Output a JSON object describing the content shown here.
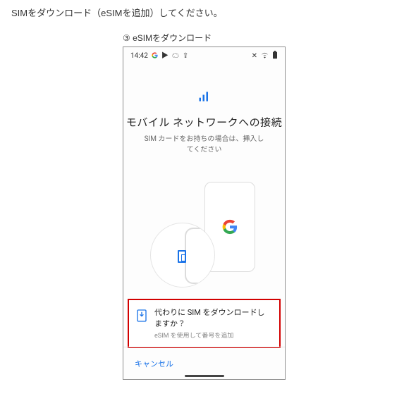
{
  "page": {
    "intro": "SIMをダウンロード（eSIMを追加）してください。",
    "caption": "③ eSIMをダウンロード"
  },
  "status": {
    "time": "14:42",
    "left_icons": [
      "G",
      "play-icon",
      "cloud-icon",
      "share-icon"
    ],
    "right_icons": [
      "silent-icon",
      "wifi-icon",
      "battery-icon"
    ]
  },
  "screen": {
    "title": "モバイル ネットワークへの接続",
    "subtitle": "SIM カードをお持ちの場合は、挿入してください"
  },
  "download": {
    "title": "代わりに SIM をダウンロードしますか？",
    "sub": "eSIM を使用して番号を追加"
  },
  "actions": {
    "cancel": "キャンセル"
  }
}
